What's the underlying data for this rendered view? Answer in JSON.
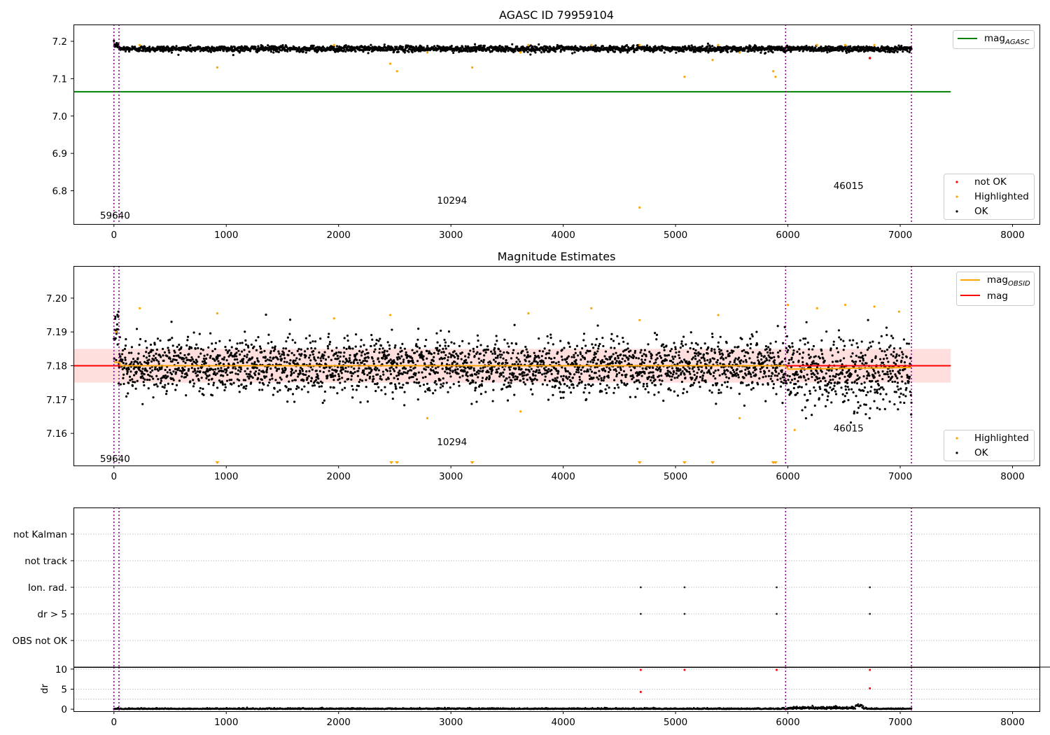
{
  "chart_data": [
    {
      "type": "scatter",
      "title": "AGASC ID 79959104",
      "xlim": [
        -360,
        8240
      ],
      "ylim": [
        6.711,
        7.245
      ],
      "xticks": [
        0,
        1000,
        2000,
        3000,
        4000,
        5000,
        6000,
        7000,
        8000
      ],
      "yticks": [
        6.8,
        6.9,
        7.0,
        7.1,
        7.2
      ],
      "ytick_decimals": 1,
      "baseline": 7.18,
      "noise": 0.004,
      "x_range": [
        0,
        7100
      ],
      "n_points": 2400,
      "vlines": [
        0,
        45,
        5980,
        7100
      ],
      "hlines": [
        {
          "name": "mag_AGASC",
          "y": 7.065,
          "x0": -360,
          "x1": 7450,
          "color": "#008000"
        }
      ],
      "highlighted_points": [
        [
          230,
          7.19
        ],
        [
          920,
          7.13
        ],
        [
          1960,
          7.19
        ],
        [
          2460,
          7.14
        ],
        [
          2520,
          7.12
        ],
        [
          2790,
          7.17
        ],
        [
          3190,
          7.13
        ],
        [
          3620,
          7.17
        ],
        [
          3690,
          7.19
        ],
        [
          4250,
          7.19
        ],
        [
          4680,
          7.19
        ],
        [
          4680,
          6.755
        ],
        [
          5080,
          7.105
        ],
        [
          5330,
          7.15
        ],
        [
          5380,
          7.19
        ],
        [
          5570,
          7.17
        ],
        [
          5870,
          7.12
        ],
        [
          5890,
          7.105
        ],
        [
          6260,
          7.19
        ],
        [
          6510,
          7.19
        ],
        [
          6770,
          7.19
        ]
      ],
      "not_ok_points": [
        [
          6730,
          7.155
        ]
      ],
      "annotations": [
        {
          "text": "59640",
          "x": 10,
          "y": 6.725
        },
        {
          "text": "10294",
          "x": 3010,
          "y": 6.765
        },
        {
          "text": "46015",
          "x": 6540,
          "y": 6.805
        }
      ],
      "legend_top": [
        {
          "label": "mag",
          "sub": "AGASC",
          "color": "#008000"
        }
      ],
      "legend_bottom": [
        {
          "label": "not OK",
          "color": "#ff0000"
        },
        {
          "label": "Highlighted",
          "color": "#ffa500"
        },
        {
          "label": "OK",
          "color": "#000000"
        }
      ],
      "colors": {
        "ok": "#000000",
        "highlighted": "#ffa500",
        "not_ok": "#ff0000",
        "vline": "#800080"
      }
    },
    {
      "type": "scatter",
      "title": "Magnitude Estimates",
      "xlim": [
        -360,
        8240
      ],
      "ylim": [
        7.1505,
        7.2095
      ],
      "xticks": [
        0,
        1000,
        2000,
        3000,
        4000,
        5000,
        6000,
        7000,
        8000
      ],
      "yticks": [
        7.16,
        7.17,
        7.18,
        7.19,
        7.2
      ],
      "ytick_decimals": 2,
      "baseline": 7.18,
      "noise": 0.004,
      "x_range": [
        0,
        7100
      ],
      "n_points": 3200,
      "vlines": [
        0,
        45,
        5980,
        7100
      ],
      "band": {
        "y0": 7.175,
        "y1": 7.185,
        "x0": -360,
        "x1": 7450,
        "color": "#ffb6b6"
      },
      "hlines": [
        {
          "name": "mag",
          "y": 7.18,
          "x0": -360,
          "x1": 7450,
          "color": "#ff0000"
        }
      ],
      "obsid_line": {
        "color": "#ffa500",
        "points": [
          [
            0,
            7.181
          ],
          [
            50,
            7.181
          ],
          [
            60,
            7.18
          ],
          [
            5980,
            7.18
          ],
          [
            6000,
            7.179
          ],
          [
            7100,
            7.1795
          ]
        ]
      },
      "highlighted_points": [
        [
          20,
          7.19
        ],
        [
          230,
          7.197
        ],
        [
          920,
          7.1955
        ],
        [
          1960,
          7.194
        ],
        [
          2460,
          7.195
        ],
        [
          2790,
          7.1645
        ],
        [
          3620,
          7.1665
        ],
        [
          3690,
          7.1955
        ],
        [
          4250,
          7.197
        ],
        [
          4680,
          7.1935
        ],
        [
          5380,
          7.195
        ],
        [
          5570,
          7.1645
        ],
        [
          6060,
          7.161
        ],
        [
          6260,
          7.197
        ],
        [
          6510,
          7.198
        ],
        [
          6770,
          7.1975
        ],
        [
          6990,
          7.196
        ],
        [
          6000,
          7.198
        ]
      ],
      "low_markers_x": [
        920,
        2470,
        2520,
        3190,
        4680,
        5080,
        5330,
        5870,
        5890
      ],
      "annotations": [
        {
          "text": "59640",
          "x": 10,
          "y": 7.1515
        },
        {
          "text": "10294",
          "x": 3010,
          "y": 7.1565
        },
        {
          "text": "46015",
          "x": 6540,
          "y": 7.1605
        }
      ],
      "legend_top": [
        {
          "label": "mag",
          "sub": "OBSID",
          "color": "#ffa500"
        },
        {
          "label": "mag",
          "sub": "",
          "color": "#ff0000"
        }
      ],
      "legend_bottom": [
        {
          "label": "Highlighted",
          "color": "#ffa500"
        },
        {
          "label": "OK",
          "color": "#000000"
        }
      ],
      "colors": {
        "ok": "#000000",
        "highlighted": "#ffa500",
        "vline": "#800080"
      }
    },
    {
      "type": "scatter",
      "title": "",
      "xlim": [
        -360,
        8240
      ],
      "categories": [
        "not Kalman",
        "not track",
        "Ion. rad.",
        "dr > 5",
        "OBS not OK"
      ],
      "flag_points": {
        "Ion. rad.": [
          4690,
          5080,
          5900,
          6730
        ],
        "dr > 5": [
          4690,
          5080,
          5900,
          6730
        ]
      },
      "vlines": [
        0,
        45,
        5980,
        7100
      ]
    },
    {
      "type": "scatter",
      "title": "",
      "xlim": [
        -360,
        8240
      ],
      "ylim": [
        -0.5,
        10.5
      ],
      "ylabel": "dr",
      "yticks": [
        0,
        5,
        10
      ],
      "xticks": [
        0,
        1000,
        2000,
        3000,
        4000,
        5000,
        6000,
        7000,
        8000
      ],
      "x_range": [
        0,
        7100
      ],
      "n_points": 2200,
      "high_points": [
        [
          4690,
          9.8
        ],
        [
          4690,
          4.3
        ],
        [
          5080,
          9.8
        ],
        [
          5900,
          9.8
        ],
        [
          6730,
          9.8
        ],
        [
          6730,
          5.2
        ]
      ],
      "vlines": [
        0,
        45,
        5980,
        7100
      ]
    }
  ]
}
